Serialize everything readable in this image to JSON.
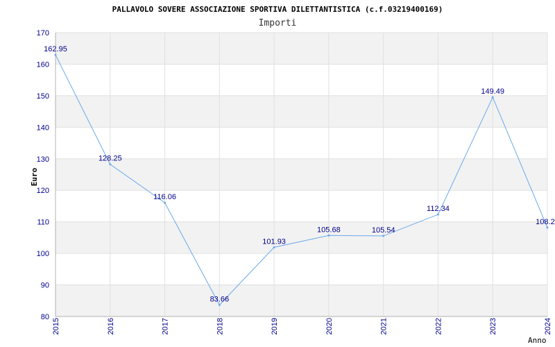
{
  "chart_data": {
    "type": "line",
    "title": "PALLAVOLO SOVERE ASSOCIAZIONE SPORTIVA DILETTANTISTICA (c.f.03219400169)",
    "subtitle": "Importi",
    "xlabel": "Anno",
    "ylabel": "Euro",
    "x": [
      "2015",
      "2016",
      "2017",
      "2018",
      "2019",
      "2020",
      "2021",
      "2022",
      "2023",
      "2024"
    ],
    "series": [
      {
        "values": [
          162.95,
          128.25,
          116.06,
          83.66,
          101.93,
          105.68,
          105.54,
          112.34,
          149.49,
          108.2
        ],
        "labels": [
          "162.95",
          "128.25",
          "116.06",
          "83.66",
          "101.93",
          "105.68",
          "105.54",
          "112.34",
          "149.49",
          "108.20"
        ],
        "color": "#6aa9ea"
      }
    ],
    "ylim": [
      80,
      170
    ],
    "yticks": [
      "80",
      "90",
      "100",
      "110",
      "120",
      "130",
      "140",
      "150",
      "160",
      "170"
    ],
    "grid": true,
    "band_colors": [
      "#f2f2f2",
      "#ffffff"
    ]
  }
}
